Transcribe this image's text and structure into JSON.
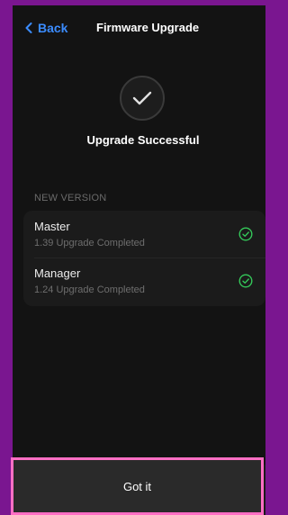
{
  "nav": {
    "back_label": "Back",
    "title": "Firmware Upgrade"
  },
  "status": {
    "icon": "checkmark-icon",
    "text": "Upgrade Successful"
  },
  "section": {
    "label": "NEW VERSION"
  },
  "devices": [
    {
      "name": "Master",
      "detail": "1.39 Upgrade Completed",
      "status_icon": "check-circle-icon"
    },
    {
      "name": "Manager",
      "detail": "1.24 Upgrade Completed",
      "status_icon": "check-circle-icon"
    }
  ],
  "action": {
    "button_label": "Got it"
  },
  "colors": {
    "accent": "#3b8cff",
    "success": "#34c759",
    "highlight": "#ff6fc4",
    "frame": "#7a1690"
  }
}
